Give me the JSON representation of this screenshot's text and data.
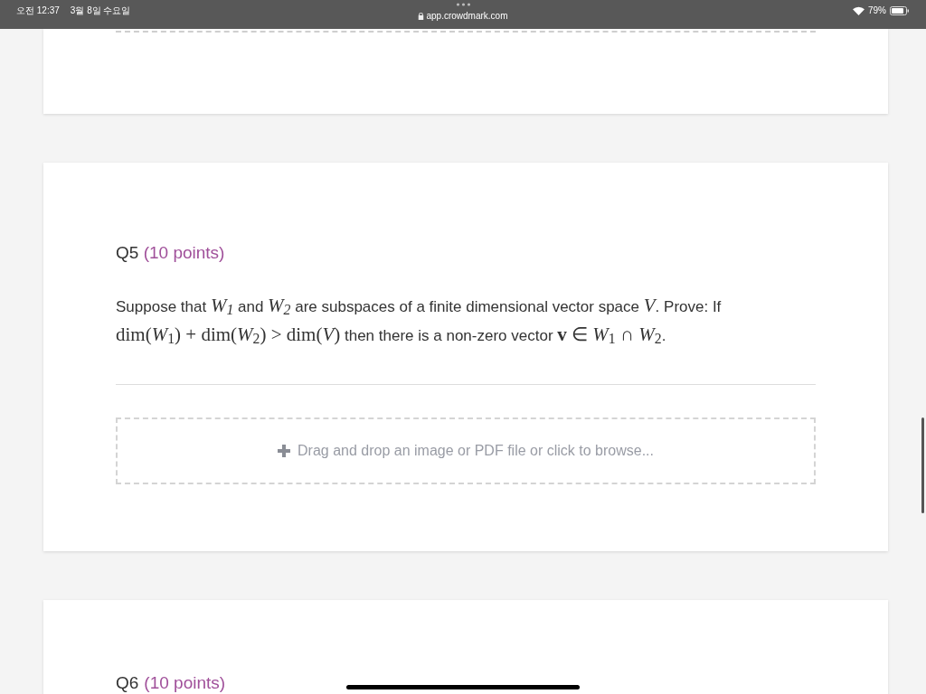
{
  "status_bar": {
    "time": "오전 12:37",
    "date": "3월 8일 수요일",
    "url": "app.crowdmark.com",
    "battery": "79%"
  },
  "questions": [
    {
      "number": "Q5",
      "points": "(10 points)",
      "prompt": [
        {
          "kind": "text",
          "text": "Suppose that "
        },
        {
          "kind": "math",
          "text": "W$_{1}$"
        },
        {
          "kind": "text",
          "text": " and "
        },
        {
          "kind": "math",
          "text": "W$_{2}$"
        },
        {
          "kind": "text",
          "text": " are subspaces of a finite dimensional vector space "
        },
        {
          "kind": "math",
          "text": "V"
        },
        {
          "kind": "text",
          "text": ". Prove: If "
        },
        {
          "kind": "mathup",
          "text": "dim(*W*$_{1}$) + dim(*W*$_{2}$) > dim(*V*)"
        },
        {
          "kind": "text",
          "text": " then there is a non-zero vector "
        },
        {
          "kind": "mathup",
          "text": "**v** ∈ *W*$_{1}$ ∩ *W*$_{2}$"
        },
        {
          "kind": "text",
          "text": "."
        }
      ],
      "upload": "Drag and drop an image or PDF file or click to browse..."
    },
    {
      "number": "Q6",
      "points": "(10 points)"
    }
  ]
}
